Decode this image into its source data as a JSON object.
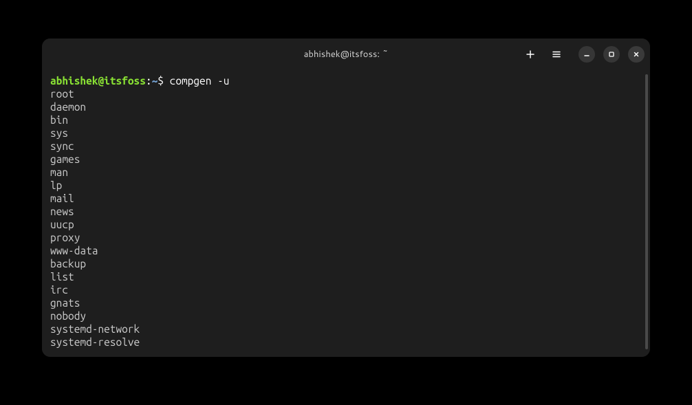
{
  "window": {
    "title": "abhishek@itsfoss: ~"
  },
  "prompt": {
    "user_host": "abhishek@itsfoss",
    "colon": ":",
    "path": "~",
    "symbol": "$ ",
    "command": "compgen -u"
  },
  "output": [
    "root",
    "daemon",
    "bin",
    "sys",
    "sync",
    "games",
    "man",
    "lp",
    "mail",
    "news",
    "uucp",
    "proxy",
    "www-data",
    "backup",
    "list",
    "irc",
    "gnats",
    "nobody",
    "systemd-network",
    "systemd-resolve"
  ],
  "icons": {
    "new_tab": "new-tab-icon",
    "menu": "menu-icon",
    "minimize": "minimize-icon",
    "maximize": "maximize-icon",
    "close": "close-icon"
  }
}
